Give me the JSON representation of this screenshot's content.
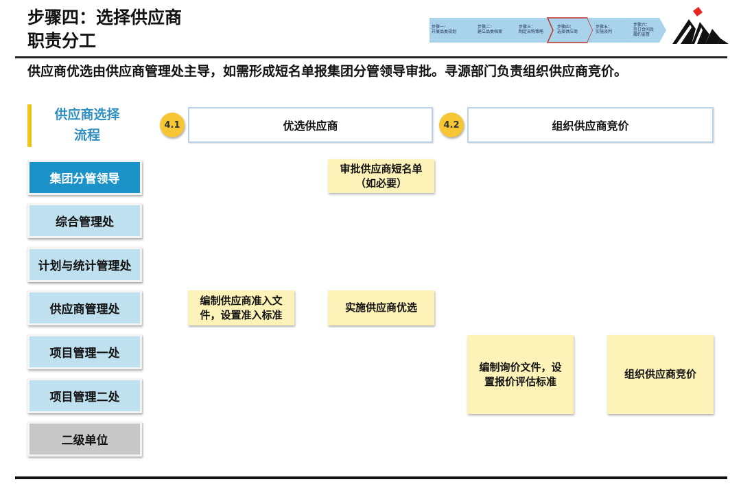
{
  "header": {
    "title": "步骤四：选择供应商\n职责分工"
  },
  "steps": [
    {
      "label": "步骤一：\n开展品类规划"
    },
    {
      "label": "步骤二：\n建立品类档案"
    },
    {
      "label": "步骤三：\n制定采购策略"
    },
    {
      "label": "步骤四：\n选择供应商"
    },
    {
      "label": "步骤五：\n实施谈判"
    },
    {
      "label": "步骤六：\n签订合同及\n履约监督"
    }
  ],
  "summary": "供应商优选由供应商管理处主导，如需形成短名单报集团分管领导审批。寻源部门负责组织供应商竞价。",
  "process_title": "供应商选择\n流程",
  "roles": [
    {
      "label": "集团分管领导"
    },
    {
      "label": "综合管理处"
    },
    {
      "label": "计划与统计管理处"
    },
    {
      "label": "供应商管理处"
    },
    {
      "label": "项目管理一处"
    },
    {
      "label": "项目管理二处"
    },
    {
      "label": "二级单位"
    }
  ],
  "phases": [
    {
      "number": "4.1",
      "label": "优选供应商"
    },
    {
      "number": "4.2",
      "label": "组织供应商竞价"
    }
  ],
  "tasks": {
    "approve_shortlist": "审批供应商短名单\n（如必要）",
    "compile_entry_docs": "编制供应商准入文\n件，设置准入标准",
    "run_selection": "实施供应商优选",
    "compile_inquiry_docs": "编制询价文件，设\n置报价评估标准",
    "organize_bidding": "组织供应商竞价"
  },
  "colors": {
    "accent_blue": "#1b92c8",
    "role_light_blue": "#bfe0ee",
    "role_gray": "#c8c8c8",
    "badge_yellow": "#f6c634",
    "task_yellow": "#fdf3b8",
    "logo_red": "#e8251f"
  }
}
